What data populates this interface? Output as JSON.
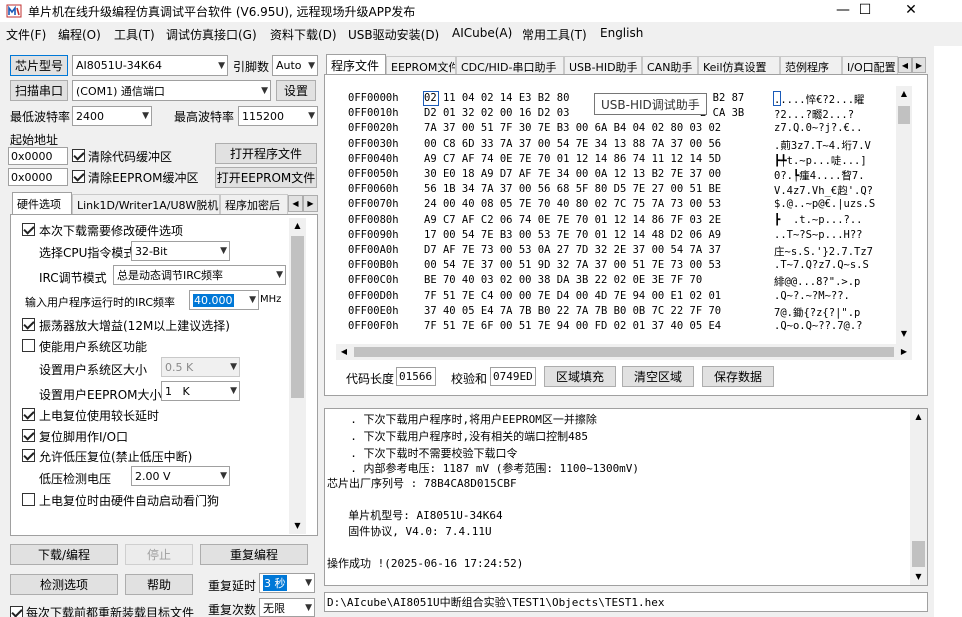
{
  "window": {
    "title": "单片机在线升级编程仿真调试平台软件 (V6.95U), 远程现场升级APP发布"
  },
  "menu": [
    "文件(F)",
    "编程(O)",
    "工具(T)",
    "调试仿真接口(G)",
    "资料下载(D)",
    "USB驱动安装(D)",
    "AICube(A)",
    "常用工具(T)",
    "English"
  ],
  "left": {
    "chip_type_button": "芯片型号",
    "chip_type_value": "AI8051U-34K64",
    "pin_count_label": "引脚数",
    "pin_count_value": "Auto",
    "scan_port_button": "扫描串口",
    "port_value": "(COM1) 通信端口",
    "settings_button": "设置",
    "min_baud_label": "最低波特率",
    "min_baud_value": "2400",
    "max_baud_label": "最高波特率",
    "max_baud_value": "115200",
    "start_addr_label": "起始地址",
    "code_addr": "0x0000",
    "clear_code_buffer": "清除代码缓冲区",
    "open_program_file": "打开程序文件",
    "eeprom_addr": "0x0000",
    "clear_eeprom_buffer": "清除EEPROM缓冲区",
    "open_eeprom_file": "打开EEPROM文件"
  },
  "option_tabs": [
    "硬件选项",
    "Link1D/Writer1A/U8W脱机",
    "程序加密后"
  ],
  "hw_options": {
    "modify_hw_on_download": "本次下载需要修改硬件选项",
    "cpu_mode_label": "选择CPU指令模式",
    "cpu_mode_value": "32-Bit",
    "irc_mode_label": "IRC调节模式",
    "irc_mode_value": "总是动态调节IRC频率",
    "irc_freq_label": "输入用户程序运行时的IRC频率",
    "irc_freq_value": "40.000",
    "irc_freq_unit": "MHz",
    "osc_gain": "振荡器放大增益(12M以上建议选择)",
    "system_area": "使能用户系统区功能",
    "sys_area_size_label": "设置用户系统区大小",
    "sys_area_size_value": "0.5 K",
    "eeprom_size_label": "设置用户EEPROM大小",
    "eeprom_size_value": "1   K",
    "longer_reset_delay": "上电复位使用较长延时",
    "reset_pin_io": "复位脚用作I/O口",
    "allow_lvr": "允许低压复位(禁止低压中断)",
    "lvd_label": "低压检测电压",
    "lvd_value": "2.00 V",
    "auto_wdt": "上电复位时由硬件自动启动看门狗"
  },
  "actions": {
    "download": "下载/编程",
    "stop": "停止",
    "reprogram": "重复编程",
    "check_options": "检测选项",
    "help": "帮助",
    "repeat_delay_label": "重复延时",
    "repeat_delay_value": "3 秒",
    "repeat_count_label": "重复次数",
    "repeat_count_value": "无限",
    "reload_target": "每次下载前都重新装载目标文件"
  },
  "right_tabs": [
    "程序文件",
    "EEPROM文件",
    "CDC/HID-串口助手",
    "USB-HID助手",
    "CAN助手",
    "Keil仿真设置",
    "范例程序",
    "I/O口配置"
  ],
  "tooltip": "USB-HID调试助手",
  "hex": {
    "rows": [
      {
        "addr": "0FF0000h",
        "bytes": "02 11 04 02 14 E3 B2 80",
        "bytes2": "6 B2 87",
        "ascii": ".....悴€?2...矅"
      },
      {
        "addr": "0FF0010h",
        "bytes": "D2 01 32 02 00 16 D2 03",
        "bytes2": "2 CA 3B",
        "ascii": "?2...?畷2...?"
      },
      {
        "addr": "0FF0020h",
        "bytes": "7A 37 00 51 7F 30 7E B3 00 6A B4 04 02 80 03 02",
        "ascii": "z7.Q.0~?j?.€.."
      },
      {
        "addr": "0FF0030h",
        "bytes": "00 C8 6D 33 7A 37 00 54 7E 34 13 88 7A 37 00 56",
        "ascii": ".萴3z7.T~4.垳7.V"
      },
      {
        "addr": "0FF0040h",
        "bytes": "A9 C7 AF 74 0E 7E 70 01 12 14 86 74 11 12 14 5D",
        "ascii": "┣╇t.~p...唗...]"
      },
      {
        "addr": "0FF0050h",
        "bytes": "30 E0 18 A9 D7 AF 7E 34 00 0A 12 13 B2 7E 37 00",
        "ascii": "0?.┡瘇4....睝7."
      },
      {
        "addr": "0FF0060h",
        "bytes": "56 1B 34 7A 37 00 56 68 5F 80 D5 7E 27 00 51 BE",
        "ascii": "V.4z7.Vh_€赹'.Q?"
      },
      {
        "addr": "0FF0070h",
        "bytes": "24 00 40 08 05 7E 70 40 80 02 7C 75 7A 73 00 53",
        "ascii": "$.@..~p@€.|uzs.S"
      },
      {
        "addr": "0FF0080h",
        "bytes": "A9 C7 AF C2 06 74 0E 7E 70 01 12 14 86 7F 03 2E",
        "ascii": "┣  .t.~p...?.."
      },
      {
        "addr": "0FF0090h",
        "bytes": "17 00 54 7E B3 00 53 7E 70 01 12 14 48 D2 06 A9",
        "ascii": "..T~?S~p...H??"
      },
      {
        "addr": "0FF00A0h",
        "bytes": "D7 AF 7E 73 00 53 0A 27 7D 32 2E 37 00 54 7A 37",
        "ascii": "庄~s.S.'}2.7.Tz7"
      },
      {
        "addr": "0FF00B0h",
        "bytes": "00 54 7E 37 00 51 9D 32 7A 37 00 51 7E 73 00 53",
        "ascii": ".T~7.Q?z7.Q~s.S"
      },
      {
        "addr": "0FF00C0h",
        "bytes": "BE 70 40 03 02 00 38 DA 3B 22 02 0E 3E 7F 70",
        "ascii": "緋@@...8?\".>.p"
      },
      {
        "addr": "0FF00D0h",
        "bytes": "7F 51 7E C4 00 00 7E D4 00 4D 7E 94 00 E1 02 01",
        "ascii": ".Q~?.~?M~??."
      },
      {
        "addr": "0FF00E0h",
        "bytes": "37 40 05 E4 7A 7B B0 22 7A 7B B0 0B 7C 22 7F 70",
        "ascii": "7@.鋤{?z{?|\".p"
      },
      {
        "addr": "0FF00F0h",
        "bytes": "7F 51 7E 6F 00 51 7E 94 00 FD 02 01 37 40 05 E4",
        "ascii": ".Q~o.Q~??.7@.?"
      }
    ],
    "code_length_label": "代码长度",
    "code_length_value": "01566",
    "checksum_label": "校验和",
    "checksum_value": "0749ED",
    "fill_button": "区域填充",
    "clear_button": "清空区域",
    "save_button": "保存数据"
  },
  "log": [
    "  . 下次下载用户程序时,将用户EEPROM区一并擦除",
    "  . 下次下载用户程序时,没有相关的端口控制485",
    "  . 下次下载时不需要校验下载口令",
    "  . 内部参考电压: 1187 mV (参考范围: 1100~1300mV)",
    "芯片出厂序列号 : 78B4CA8D015CBF",
    "",
    "  单片机型号: AI8051U-34K64",
    "  固件协议, V4.0: 7.4.11U",
    "",
    "操作成功 !(2025-06-16 17:24:52)"
  ],
  "file_path": "D:\\AIcube\\AI8051U中断组合实验\\TEST1\\Objects\\TEST1.hex"
}
